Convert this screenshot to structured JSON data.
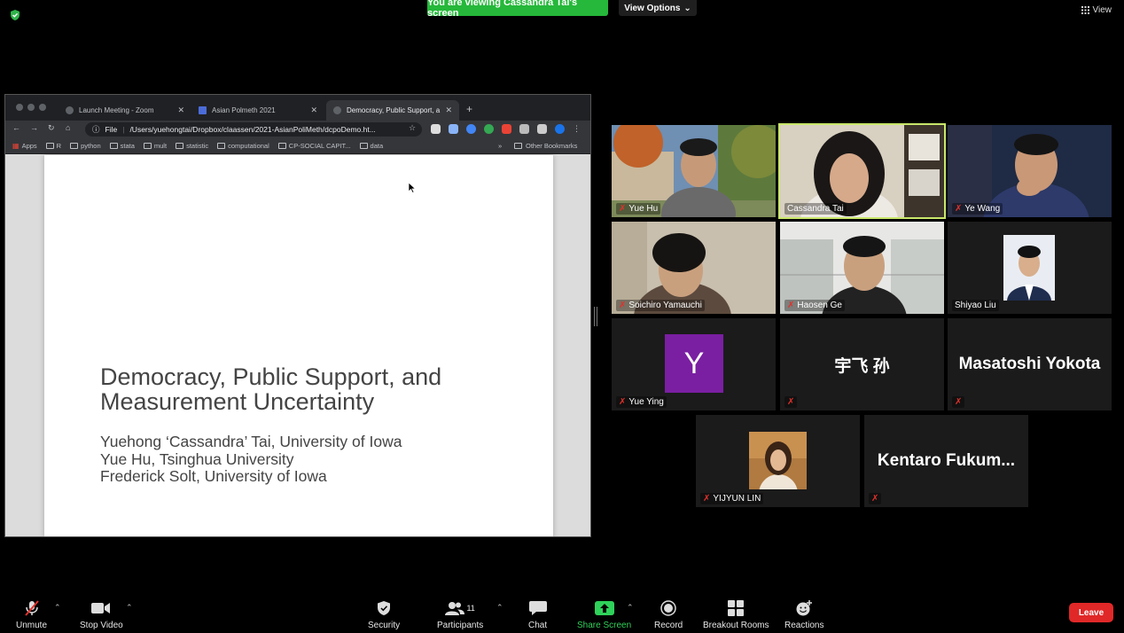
{
  "banner": {
    "text": "You are viewing Cassandra Tai's screen"
  },
  "view_options": {
    "label": "View Options"
  },
  "view": {
    "label": "View"
  },
  "browser": {
    "tabs": [
      {
        "label": "Launch Meeting - Zoom"
      },
      {
        "label": "Asian Polmeth 2021"
      },
      {
        "label": "Democracy, Public Support, a"
      }
    ],
    "address": {
      "scheme": "File",
      "url": "/Users/yuehongtai/Dropbox/claassen/2021-AsianPoliMeth/dcpoDemo.ht..."
    },
    "bookmarks": [
      "Apps",
      "R",
      "python",
      "stata",
      "mult",
      "statistic",
      "computational",
      "CP-SOCIAL CAPIT...",
      "data"
    ],
    "other_bookmarks": "Other Bookmarks"
  },
  "slide": {
    "title_line1": "Democracy, Public Support, and",
    "title_line2": "Measurement Uncertainty",
    "author1": "Yuehong ‘Cassandra’ Tai, University of Iowa",
    "author2": "Yue Hu, Tsinghua University",
    "author3": "Frederick Solt, University of Iowa"
  },
  "participants": [
    {
      "name": "Yue Hu",
      "muted": true
    },
    {
      "name": "Cassandra Tai",
      "muted": false,
      "speaking": true
    },
    {
      "name": "Ye Wang",
      "muted": true
    },
    {
      "name": "Soichiro Yamauchi",
      "muted": true
    },
    {
      "name": "Haosen Ge",
      "muted": true
    },
    {
      "name": "Shiyao Liu",
      "muted": false
    },
    {
      "name": "Yue Ying",
      "muted": true,
      "avatar_letter": "Y"
    },
    {
      "name": "宇飞 孙",
      "muted": true
    },
    {
      "name": "Masatoshi Yokota",
      "muted": true
    },
    {
      "name": "YIJYUN LIN",
      "muted": true
    },
    {
      "name": "Kentaro  Fukum...",
      "muted": true
    }
  ],
  "toolbar": {
    "unmute": "Unmute",
    "stop_video": "Stop Video",
    "security": "Security",
    "participants": "Participants",
    "participants_count": "11",
    "chat": "Chat",
    "share_screen": "Share Screen",
    "record": "Record",
    "breakout_rooms": "Breakout Rooms",
    "reactions": "Reactions",
    "leave": "Leave"
  },
  "colors": {
    "banner_green": "#25b83a",
    "speaking_outline": "#c9e76a",
    "leave_red": "#e02828",
    "share_green": "#2fd15a",
    "avatar_purple": "#7a1fa2",
    "muted_red": "#e0312b"
  }
}
